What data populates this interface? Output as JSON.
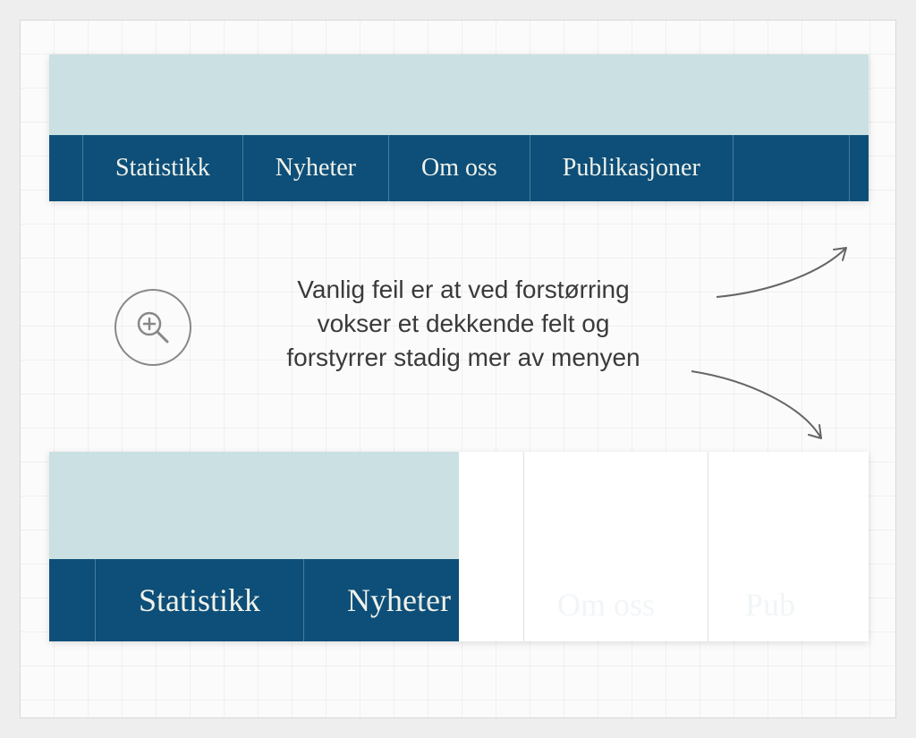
{
  "menu": {
    "items": [
      "Statistikk",
      "Nyheter",
      "Om oss",
      "Publikasjoner"
    ]
  },
  "bottom_menu": {
    "items": [
      "Statistikk",
      "Nyheter",
      "Om oss",
      "Pub"
    ]
  },
  "annotation": {
    "line1": "Vanlig feil er at ved forstørring",
    "line2": "vokser et dekkende felt og",
    "line3": "forstyrrer stadig mer av menyen"
  },
  "colors": {
    "banner": "#cbe0e2",
    "menubar": "#0d4f79",
    "menutext": "#f1f2ea",
    "annotation_text": "#3a3a3a",
    "icon_stroke": "#888"
  }
}
